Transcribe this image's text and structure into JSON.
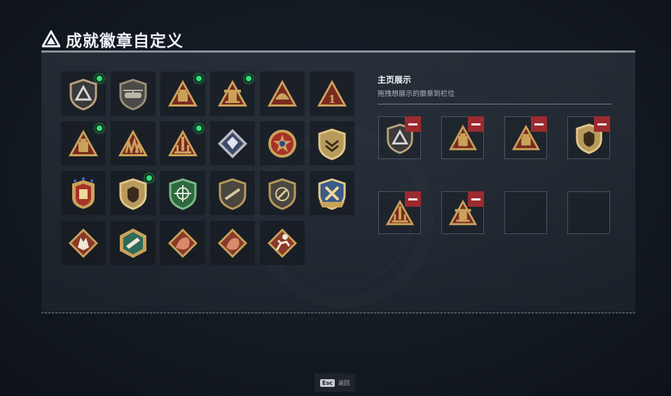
{
  "header": {
    "title": "成就徽章自定义",
    "logo_icon": "triangle-logo-icon"
  },
  "showcase": {
    "title": "主页展示",
    "subtitle": "拖拽想展示的徽章到栏位"
  },
  "badges": [
    {
      "icon": "shield-delta-badge",
      "new": true
    },
    {
      "icon": "helicopter-badge",
      "new": false
    },
    {
      "icon": "crate-triangle-badge",
      "new": true
    },
    {
      "icon": "turret-triangle-badge",
      "new": true
    },
    {
      "icon": "helmet-triangle-badge",
      "new": false
    },
    {
      "icon": "number-one-triangle-badge",
      "new": false
    },
    {
      "icon": "backpack-triangle-badge",
      "new": true
    },
    {
      "icon": "soldiers-triangle-badge",
      "new": false
    },
    {
      "icon": "rocket-triangle-badge",
      "new": true
    },
    {
      "icon": "crystal-diamond-badge",
      "new": false
    },
    {
      "icon": "star-medal-badge",
      "new": false
    },
    {
      "icon": "chevron-shield-badge",
      "new": false
    },
    {
      "icon": "eagle-crest-badge",
      "new": false
    },
    {
      "icon": "armor-shield-badge",
      "new": true
    },
    {
      "icon": "green-crosshair-badge",
      "new": false
    },
    {
      "icon": "rifle-shield-badge",
      "new": false
    },
    {
      "icon": "no-gun-shield-badge",
      "new": false
    },
    {
      "icon": "wrench-shield-badge",
      "new": false
    },
    {
      "icon": "wolf-diamond-badge",
      "new": false
    },
    {
      "icon": "gun-hexagon-badge",
      "new": false
    },
    {
      "icon": "dragon-diamond-badge",
      "new": false
    },
    {
      "icon": "beast-diamond-badge",
      "new": false
    },
    {
      "icon": "runner-diamond-badge",
      "new": false
    }
  ],
  "showcase_slots": [
    {
      "icon": "shield-delta-badge",
      "filled": true
    },
    {
      "icon": "backpack-triangle-badge",
      "filled": true
    },
    {
      "icon": "crate-triangle-badge",
      "filled": true
    },
    {
      "icon": "armor-shield-badge",
      "filled": true
    },
    {
      "icon": "rocket-triangle-badge",
      "filled": true
    },
    {
      "icon": "turret-triangle-badge",
      "filled": true
    },
    {
      "icon": "",
      "filled": false
    },
    {
      "icon": "",
      "filled": false
    }
  ],
  "footer": {
    "key": "Esc",
    "label": "返回"
  },
  "colors": {
    "green_dot": "#33e07a",
    "remove_red": "#9c2a2f",
    "gold": "#c9a25a",
    "maroon": "#7a2a20"
  }
}
